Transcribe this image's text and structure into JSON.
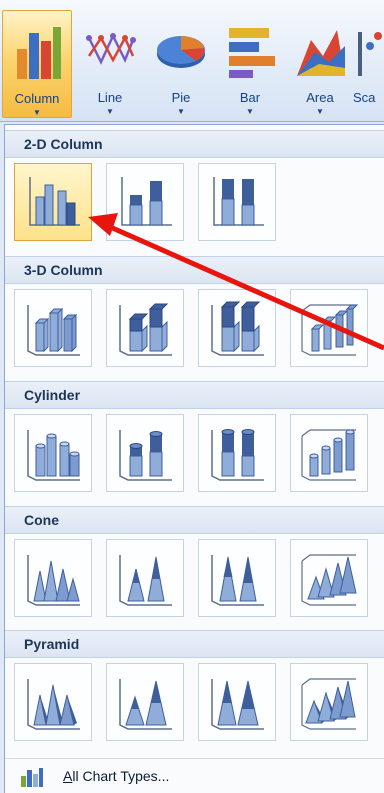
{
  "ribbon": {
    "buttons": [
      {
        "label": "Column",
        "icon": "column-chart-icon",
        "active": true
      },
      {
        "label": "Line",
        "icon": "line-chart-icon"
      },
      {
        "label": "Pie",
        "icon": "pie-chart-icon"
      },
      {
        "label": "Bar",
        "icon": "bar-chart-icon"
      },
      {
        "label": "Area",
        "icon": "area-chart-icon"
      },
      {
        "label": "Sca",
        "icon": "scatter-chart-icon"
      }
    ],
    "dropdown_arrow": "▼"
  },
  "sections": [
    {
      "title": "2-D Column",
      "items": [
        "clustered-column-icon",
        "stacked-column-icon",
        "100-stacked-column-icon"
      ],
      "selected_index": 0
    },
    {
      "title": "3-D Column",
      "items": [
        "3d-clustered-column-icon",
        "3d-stacked-column-icon",
        "3d-100-stacked-column-icon",
        "3d-column-icon"
      ]
    },
    {
      "title": "Cylinder",
      "items": [
        "clustered-cylinder-icon",
        "stacked-cylinder-icon",
        "100-stacked-cylinder-icon",
        "3d-cylinder-icon"
      ]
    },
    {
      "title": "Cone",
      "items": [
        "clustered-cone-icon",
        "stacked-cone-icon",
        "100-stacked-cone-icon",
        "3d-cone-icon"
      ]
    },
    {
      "title": "Pyramid",
      "items": [
        "clustered-pyramid-icon",
        "stacked-pyramid-icon",
        "100-stacked-pyramid-icon",
        "3d-pyramid-icon"
      ]
    }
  ],
  "footer": {
    "label_underlined": "A",
    "label_rest": "ll Chart Types...",
    "icon": "all-chart-types-icon"
  },
  "annotation": {
    "color": "#e8150f"
  },
  "colors": {
    "accent": "#f6bb42",
    "bar_fill": "#6f8fc7",
    "bar_dark": "#3f5f9c",
    "header_text": "#1d3557"
  }
}
